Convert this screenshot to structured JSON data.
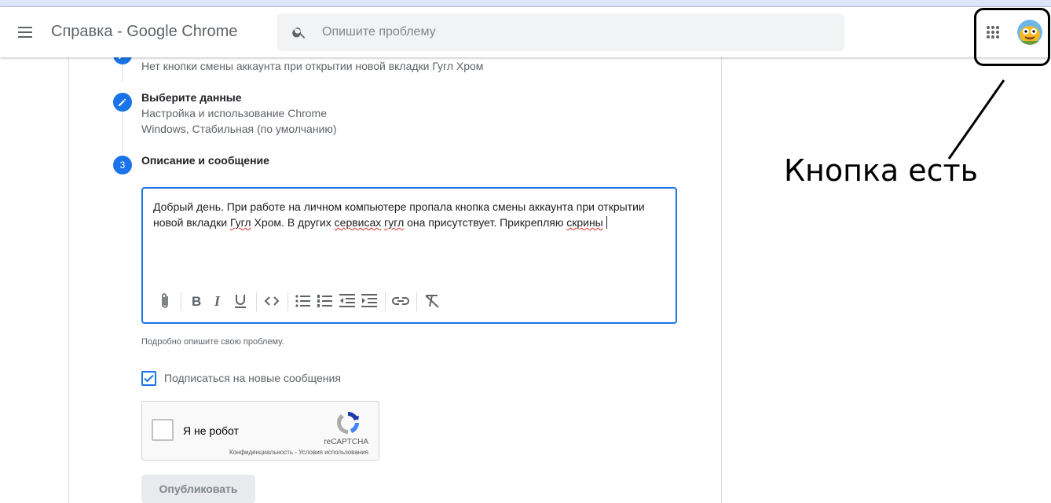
{
  "app": {
    "title": "Справка - Google Chrome",
    "menu_icon": "menu-icon",
    "apps_icon": "apps-grid-icon"
  },
  "search": {
    "placeholder": "Опишите проблему",
    "icon": "search-icon"
  },
  "steps": [
    {
      "subtitle": "Нет кнопки смены аккаунта при открытии новой вкладки Гугл Хром",
      "icon": "pencil-icon"
    },
    {
      "title": "Выберите данные",
      "subtitle_lines": [
        "Настройка и использование Chrome",
        "Windows, Стабильная (по умолчанию)"
      ],
      "icon": "pencil-icon"
    },
    {
      "number": "3",
      "title": "Описание и сообщение"
    }
  ],
  "editor": {
    "text_parts": [
      "Добрый день. При работе на личном компьютере пропала кнопка смены аккаунта при открытии новой вкладки ",
      "Гугл",
      " Хром. В других ",
      "сервисах",
      " ",
      "гугл",
      " она присутствует. Прикрепляю ",
      "скрины"
    ],
    "toolbar": [
      "attach-icon",
      "bold-icon",
      "italic-icon",
      "underline-icon",
      "code-icon",
      "bulleted-list-icon",
      "numbered-list-icon",
      "outdent-icon",
      "indent-icon",
      "link-icon",
      "clear-format-icon"
    ]
  },
  "hint": "Подробно опишите свою проблему.",
  "subscribe": {
    "label": "Подписаться на новые сообщения",
    "checked": true
  },
  "recaptcha": {
    "label": "Я не робот",
    "brand": "reCAPTCHA",
    "links": "Конфиденциальность - Условия использования"
  },
  "publish_label": "Опубликовать",
  "annotation": {
    "text": "Кнопка есть"
  },
  "colors": {
    "accent": "#1a73e8",
    "annotation": "#000000"
  }
}
